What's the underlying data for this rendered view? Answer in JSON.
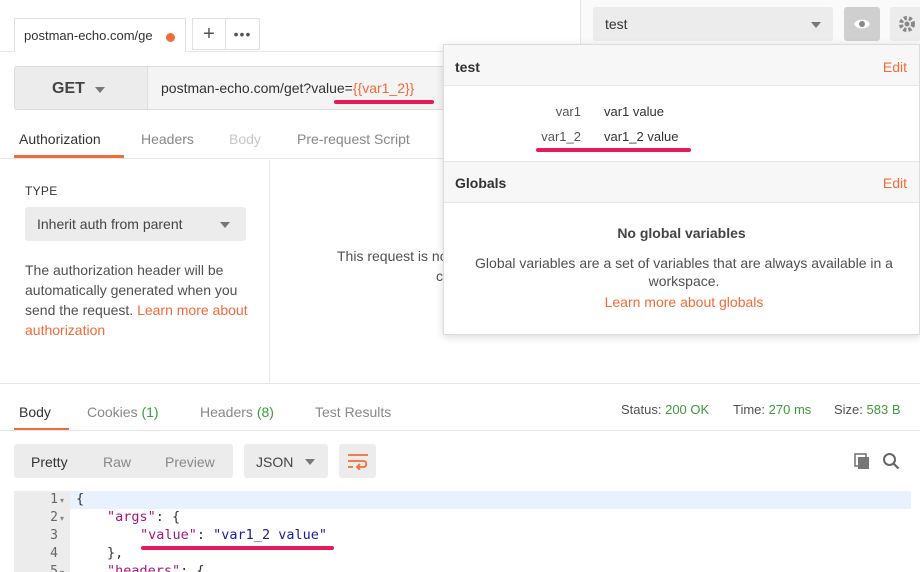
{
  "tabs": {
    "request_tab_label": "postman-echo.com/ge",
    "add_tab": "+",
    "more": "•••"
  },
  "environment": {
    "selected": "test"
  },
  "request": {
    "method": "GET",
    "url_prefix": "postman-echo.com/get?value=",
    "url_variable": "{{var1_2}}"
  },
  "request_tabs": [
    "Authorization",
    "Headers",
    "Body",
    "Pre-request Script"
  ],
  "auth": {
    "type_label": "TYPE",
    "type_value": "Inherit auth from parent",
    "description": "The authorization header will be automatically generated when you send the request.",
    "learn_more": "Learn more about authorization",
    "note": "This request is no",
    "note2": "c"
  },
  "env_popover": {
    "env_name": "test",
    "edit_label": "Edit",
    "variables": [
      {
        "key": "var1",
        "value": "var1 value"
      },
      {
        "key": "var1_2",
        "value": "var1_2 value"
      }
    ],
    "globals_title": "Globals",
    "globals_edit": "Edit",
    "no_globals": "No global variables",
    "globals_desc": "Global variables are a set of variables that are always available in a workspace.",
    "globals_link": "Learn more about globals"
  },
  "response": {
    "tabs": {
      "body": "Body",
      "cookies": "Cookies",
      "cookies_count": "(1)",
      "headers": "Headers",
      "headers_count": "(8)",
      "tests": "Test Results"
    },
    "status_label": "Status:",
    "status_value": "200 OK",
    "time_label": "Time:",
    "time_value": "270 ms",
    "size_label": "Size:",
    "size_value": "583 B",
    "formats": [
      "Pretty",
      "Raw",
      "Preview"
    ],
    "format_type": "JSON",
    "lines": [
      "1",
      "2",
      "3",
      "4",
      "5"
    ]
  },
  "code": {
    "line1": "{",
    "line2_key": "\"args\"",
    "line2_rest": ": {",
    "line3_key": "\"value\"",
    "line3_sep": ": ",
    "line3_val": "\"var1_2 value\"",
    "line4": "},",
    "line5_key": "\"headers\"",
    "line5_rest": ": {"
  },
  "colors": {
    "accent": "#f26b3a",
    "status_ok": "#3c9b3c",
    "annotation": "#e8195a"
  }
}
